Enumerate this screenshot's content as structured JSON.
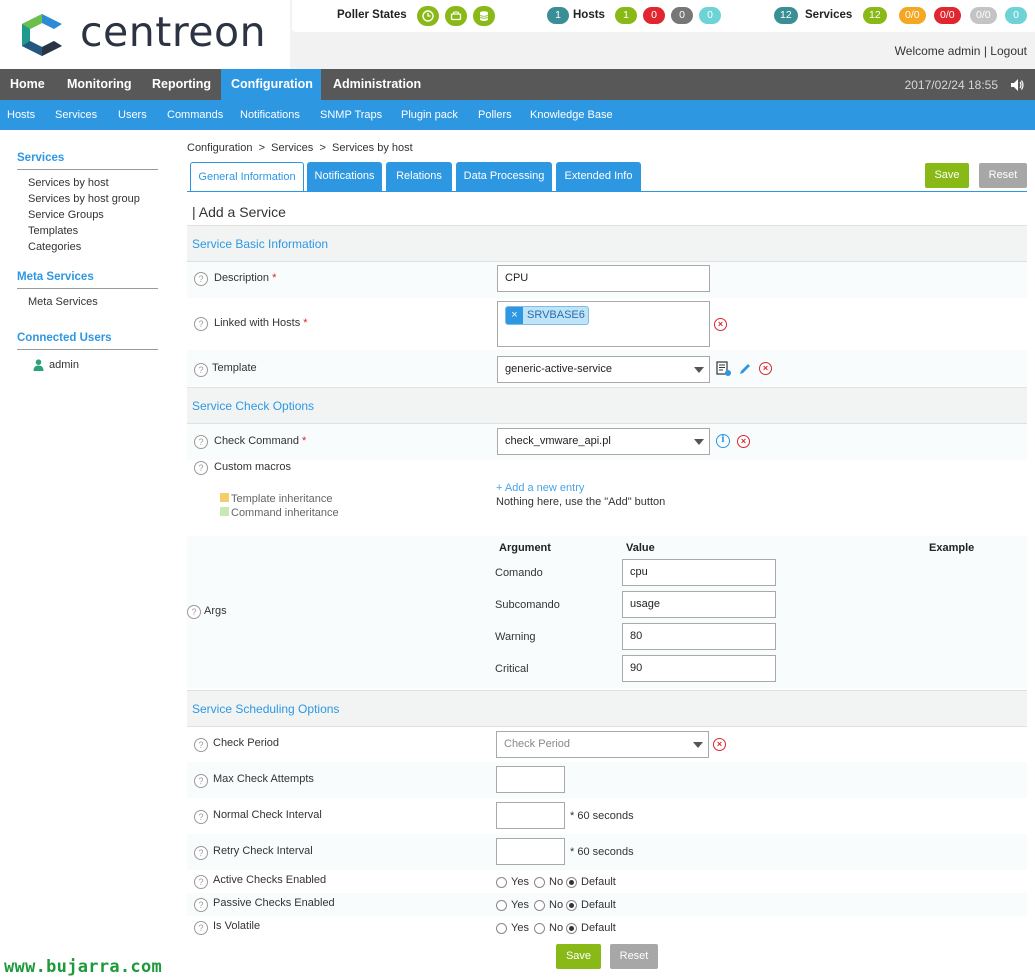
{
  "header": {
    "logo_text": "centreon",
    "poller_states_label": "Poller States",
    "hosts": {
      "total": "1",
      "label": "Hosts",
      "up": "1",
      "down": "0",
      "unreachable": "0",
      "pending": "0"
    },
    "services": {
      "total": "12",
      "label": "Services",
      "ok": "12",
      "warning": "0/0",
      "critical": "0/0",
      "unknown": "0/0",
      "pending": "0"
    },
    "welcome_text": "Welcome admin",
    "separator": "|",
    "logout_label": "Logout",
    "colors": {
      "green": "#88b917",
      "red": "#e0262f",
      "orange": "#f5a623",
      "grey": "#777777",
      "light_grey": "#c4c4c4",
      "cyan": "#6dd3d6",
      "teal": "#3a8f96"
    }
  },
  "menu": {
    "items": [
      "Home",
      "Monitoring",
      "Reporting",
      "Configuration",
      "Administration"
    ],
    "active": "Configuration",
    "clock": "2017/02/24 18:55"
  },
  "submenu": {
    "items": [
      "Hosts",
      "Services",
      "Users",
      "Commands",
      "Notifications",
      "SNMP Traps",
      "Plugin pack",
      "Pollers",
      "Knowledge Base"
    ]
  },
  "sidebar": {
    "services_title": "Services",
    "services_items": [
      "Services by host",
      "Services by host group",
      "Service Groups",
      "Templates",
      "Categories"
    ],
    "meta_title": "Meta Services",
    "meta_items": [
      "Meta Services"
    ],
    "users_title": "Connected Users",
    "users": [
      "admin"
    ]
  },
  "breadcrumb": {
    "a": "Configuration",
    "sep": ">",
    "b": "Services",
    "c": "Services by host"
  },
  "tabs": [
    "General Information",
    "Notifications",
    "Relations",
    "Data Processing",
    "Extended Info"
  ],
  "buttons": {
    "save": "Save",
    "reset": "Reset"
  },
  "page_title": "| Add a Service",
  "sections": {
    "basic": "Service Basic Information",
    "check": "Service Check Options",
    "scheduling": "Service Scheduling Options"
  },
  "fields": {
    "description": {
      "label": "Description",
      "required": "*",
      "value": "CPU"
    },
    "linked_hosts": {
      "label": "Linked with Hosts",
      "required": "*",
      "tag": "SRVBASE6",
      "tag_remove": "×"
    },
    "template": {
      "label": "Template",
      "value": "generic-active-service"
    },
    "check_command": {
      "label": "Check Command",
      "required": "*",
      "value": "check_vmware_api.pl"
    },
    "custom_macros": {
      "label": "Custom macros",
      "legend_template": "Template inheritance",
      "legend_command": "Command inheritance",
      "add_link": "+ Add a new entry",
      "empty_text": "Nothing here, use the \"Add\" button"
    },
    "args": {
      "label": "Args",
      "headers": {
        "argument": "Argument",
        "value": "Value",
        "example": "Example"
      },
      "rows": [
        {
          "argument": "Comando",
          "value": "cpu"
        },
        {
          "argument": "Subcomando",
          "value": "usage"
        },
        {
          "argument": "Warning",
          "value": "80"
        },
        {
          "argument": "Critical",
          "value": "90"
        }
      ]
    },
    "check_period": {
      "label": "Check Period",
      "placeholder": "Check Period"
    },
    "max_check_attempts": {
      "label": "Max Check Attempts",
      "value": ""
    },
    "normal_check_interval": {
      "label": "Normal Check Interval",
      "value": "",
      "suffix": "* 60 seconds"
    },
    "retry_check_interval": {
      "label": "Retry Check Interval",
      "value": "",
      "suffix": "* 60 seconds"
    },
    "active_checks": {
      "label": "Active Checks Enabled"
    },
    "passive_checks": {
      "label": "Passive Checks Enabled"
    },
    "is_volatile": {
      "label": "Is Volatile"
    },
    "radio_options": {
      "yes": "Yes",
      "no": "No",
      "default": "Default"
    }
  },
  "help_glyph": "?",
  "watermark": "www.bujarra.com"
}
